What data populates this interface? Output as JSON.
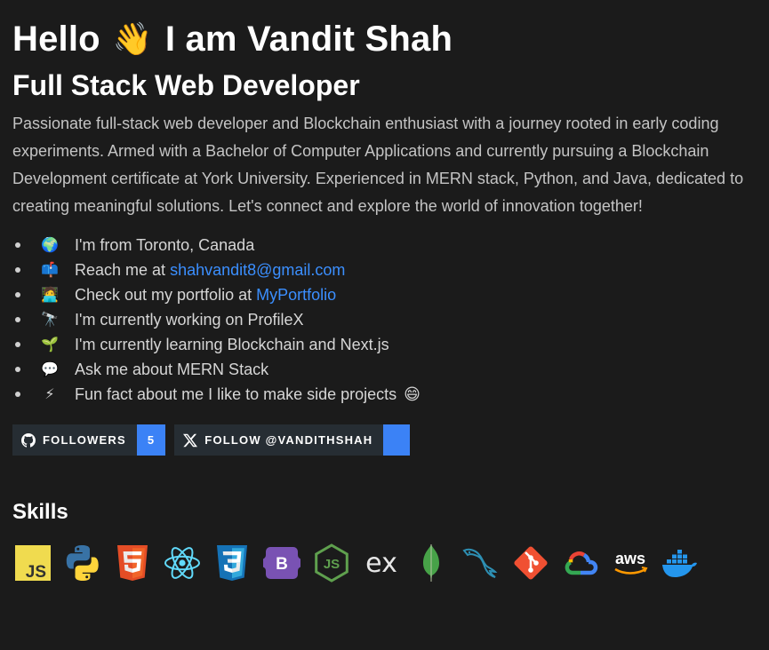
{
  "header": {
    "hello": "Hello",
    "wave_emoji": "👋",
    "name_line": "I am Vandit Shah",
    "subtitle": "Full Stack Web Developer"
  },
  "bio": "Passionate full-stack web developer and Blockchain enthusiast with a journey rooted in early coding experiments. Armed with a Bachelor of Computer Applications and currently pursuing a Blockchain Development certificate at York University. Experienced in MERN stack, Python, and Java, dedicated to creating meaningful solutions. Let's connect and explore the world of innovation together!",
  "facts": [
    {
      "emoji": "🌍",
      "text": "I'm from Toronto, Canada"
    },
    {
      "emoji": "📫",
      "text": "Reach me at",
      "link": "shahvandit8@gmail.com"
    },
    {
      "emoji": "🧑‍💻",
      "text": "Check out my portfolio at",
      "link": "MyPortfolio"
    },
    {
      "emoji": "🔭",
      "text": "I'm currently working on ProfileX"
    },
    {
      "emoji": "🌱",
      "text": "I'm currently learning Blockchain and Next.js"
    },
    {
      "emoji": "💬",
      "text": "Ask me about MERN Stack"
    },
    {
      "emoji": "⚡",
      "text": "Fun fact about me I like to make side projects",
      "trail_emoji": "😄"
    }
  ],
  "badges": {
    "followers_label": "FOLLOWERS",
    "followers_count": "5",
    "twitter_label": "FOLLOW @VANDITHSHAH"
  },
  "skills_title": "Skills",
  "skills": [
    {
      "icon": "javascript-icon"
    },
    {
      "icon": "python-icon"
    },
    {
      "icon": "html5-icon"
    },
    {
      "icon": "react-icon"
    },
    {
      "icon": "css3-icon"
    },
    {
      "icon": "bootstrap-icon",
      "text": "B"
    },
    {
      "icon": "nodejs-icon",
      "text": "JS"
    },
    {
      "icon": "express-icon",
      "text": "ex"
    },
    {
      "icon": "mongodb-icon"
    },
    {
      "icon": "mysql-icon"
    },
    {
      "icon": "git-icon"
    },
    {
      "icon": "google-cloud-icon"
    },
    {
      "icon": "aws-icon",
      "text": "aws"
    },
    {
      "icon": "docker-icon"
    }
  ],
  "colors": {
    "background": "#1b1b1b",
    "link": "#3b8fff",
    "badge_dark": "#262d33",
    "badge_blue": "#3b82f6"
  }
}
